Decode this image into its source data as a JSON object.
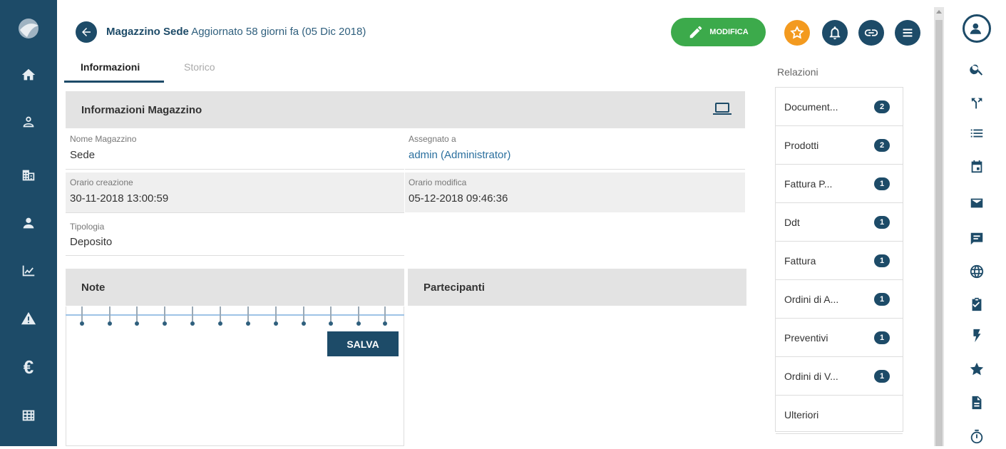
{
  "header": {
    "title_bold": "Magazzino Sede",
    "title_sub": "Aggiornato 58 giorni fa (05 Dic 2018)",
    "edit_label": "MODIFICA"
  },
  "tabs": [
    {
      "label": "Informazioni",
      "active": true
    },
    {
      "label": "Storico",
      "active": false
    }
  ],
  "info_section": {
    "title": "Informazioni Magazzino",
    "fields": {
      "nome_label": "Nome Magazzino",
      "nome_value": "Sede",
      "assegnato_label": "Assegnato a",
      "assegnato_value": "admin (Administrator)",
      "creazione_label": "Orario creazione",
      "creazione_value": "30-11-2018 13:00:59",
      "modifica_label": "Orario modifica",
      "modifica_value": "05-12-2018 09:46:36",
      "tipologia_label": "Tipologia",
      "tipologia_value": "Deposito"
    }
  },
  "notes": {
    "title": "Note",
    "save_label": "SALVA"
  },
  "participants": {
    "title": "Partecipanti"
  },
  "relations": {
    "title": "Relazioni",
    "items": [
      {
        "label": "Document...",
        "count": "2"
      },
      {
        "label": "Prodotti",
        "count": "2"
      },
      {
        "label": "Fattura P...",
        "count": "1"
      },
      {
        "label": "Ddt",
        "count": "1"
      },
      {
        "label": "Fattura",
        "count": "1"
      },
      {
        "label": "Ordini di A...",
        "count": "1"
      },
      {
        "label": "Preventivi",
        "count": "1"
      },
      {
        "label": "Ordini di V...",
        "count": "1"
      },
      {
        "label": "Ulteriori",
        "count": null
      }
    ]
  },
  "colors": {
    "brand": "#1d4b68",
    "edit_green": "#3caa4b",
    "star_orange": "#f39a1f"
  },
  "icons": {
    "left_nav": [
      "home-icon",
      "contacts-icon",
      "company-icon",
      "user-icon",
      "chart-icon",
      "warning-icon",
      "euro-icon",
      "table-icon"
    ],
    "right_bar": [
      "avatar",
      "search-icon",
      "merge-icon",
      "list-icon",
      "calendar-icon",
      "mail-icon",
      "chat-icon",
      "globe-icon",
      "clipboard-check-icon",
      "flash-icon",
      "star-icon",
      "document-icon",
      "timer-icon"
    ],
    "header_actions": [
      "star-icon",
      "bell-icon",
      "link-icon",
      "menu-icon"
    ]
  }
}
